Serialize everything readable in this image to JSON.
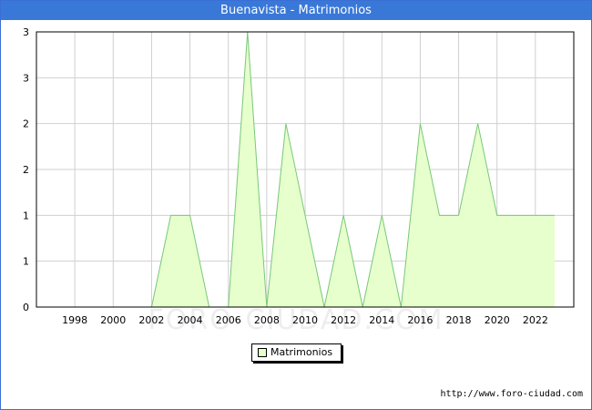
{
  "title": "Buenavista - Matrimonios",
  "source": "http://www.foro-ciudad.com",
  "watermark": "FORO-CIUDAD.COM",
  "colors": {
    "fill": "#e6ffcc",
    "line": "#78c878",
    "grid": "#d0d0d0",
    "titlebar": "#3a78d8"
  },
  "chart_data": {
    "type": "area",
    "title": "Buenavista - Matrimonios",
    "xlabel": "",
    "ylabel": "",
    "x": [
      2002,
      2003,
      2004,
      2005,
      2006,
      2007,
      2008,
      2009,
      2010,
      2011,
      2012,
      2013,
      2014,
      2015,
      2016,
      2017,
      2018,
      2019,
      2020,
      2021,
      2022,
      2023
    ],
    "series": [
      {
        "name": "Matrimonios",
        "values": [
          0,
          1,
          1,
          0,
          0,
          3,
          0,
          2,
          1,
          0,
          1,
          0,
          1,
          0,
          2,
          1,
          1,
          2,
          1,
          1,
          1,
          1
        ]
      }
    ],
    "xlim": [
      1996,
      2024
    ],
    "ylim": [
      0,
      3
    ],
    "x_ticks": [
      "1998",
      "2000",
      "2002",
      "2004",
      "2006",
      "2008",
      "2010",
      "2012",
      "2014",
      "2016",
      "2018",
      "2020",
      "2022"
    ],
    "y_ticks": [
      "0",
      "1",
      "1",
      "2",
      "2",
      "3",
      "3"
    ],
    "grid": true,
    "legend_position": "bottom-center"
  }
}
